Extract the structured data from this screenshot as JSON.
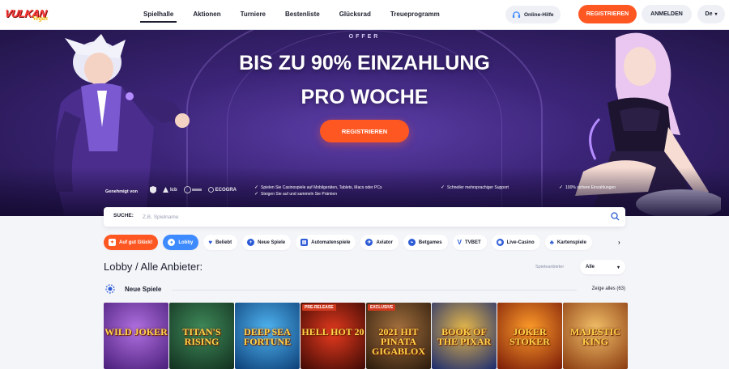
{
  "brand": {
    "name": "VULKAN",
    "sub": "Vegas"
  },
  "nav": [
    "Spielhalle",
    "Aktionen",
    "Turniere",
    "Bestenliste",
    "Glücksrad",
    "Treueprogramm"
  ],
  "header": {
    "help": "Online-Hilfe",
    "register": "REGISTRIEREN",
    "login": "ANMELDEN",
    "lang": "De"
  },
  "hero": {
    "offer": "OFFER",
    "line1": "BIS ZU 90% EINZAHLUNG",
    "line2": "PRO WOCHE",
    "cta": "REGISTRIEREN",
    "licensed": "Genehmigt von",
    "license_logos": [
      "lcb",
      "ECOGRA"
    ],
    "features": [
      "Spielen Sie Casinospiele auf Mobilgeräten, Tablets, Macs oder PCs",
      "Steigen Sie auf und sammeln Sie Prämien",
      "Schneller mehrsprachiger Support",
      "100% sichere Einzahlungen"
    ]
  },
  "search": {
    "label": "SUCHE:",
    "placeholder": "Z.B. Spielname"
  },
  "chips": [
    {
      "label": "Auf gut Glück!",
      "icon": "dice-icon",
      "color": "#ffffff"
    },
    {
      "label": "Lobby",
      "icon": "lobby-icon",
      "color": "#ffffff"
    },
    {
      "label": "Beliebt",
      "icon": "heart-icon",
      "color": "#2d5bd6"
    },
    {
      "label": "Neue Spiele",
      "icon": "new-icon",
      "color": "#2d5bd6"
    },
    {
      "label": "Automatenspiele",
      "icon": "slot-icon",
      "color": "#2d5bd6"
    },
    {
      "label": "Aviator",
      "icon": "aviator-icon",
      "color": "#2d5bd6"
    },
    {
      "label": "Betgames",
      "icon": "betgames-icon",
      "color": "#2d5bd6"
    },
    {
      "label": "TVBET",
      "icon": "tvbet-icon",
      "color": "#2d5bd6"
    },
    {
      "label": "Live-Casino",
      "icon": "live-icon",
      "color": "#2d5bd6"
    },
    {
      "label": "Kartenspiele",
      "icon": "cards-icon",
      "color": "#2d5bd6"
    }
  ],
  "lobby": {
    "title": "Lobby / Alle Anbieter:",
    "provider_label": "Spieleanbieter",
    "provider_value": "Alle",
    "section_title": "Neue Spiele",
    "show_all": "Zeige alles (63)"
  },
  "games": [
    {
      "title": "WILD JOKER",
      "bg": "#7a3fb8",
      "badge": ""
    },
    {
      "title": "TITAN'S RISING",
      "bg": "#1f5a3a",
      "badge": ""
    },
    {
      "title": "DEEP SEA FORTUNE",
      "bg": "#1b76c2",
      "badge": ""
    },
    {
      "title": "HELL HOT 20",
      "bg": "#8a1c0e",
      "badge": "PRE-RELEASE"
    },
    {
      "title": "2021 HIT PINATA GIGABLOX",
      "bg": "#5b3a1e",
      "badge": "EXCLUSIVE"
    },
    {
      "title": "BOOK OF THE PIXAR",
      "bg": "#2c3f8f",
      "badge": ""
    },
    {
      "title": "JOKER STOKER",
      "bg": "#d04a12",
      "badge": ""
    },
    {
      "title": "MAJESTIC KING",
      "bg": "#c0651a",
      "badge": ""
    }
  ]
}
